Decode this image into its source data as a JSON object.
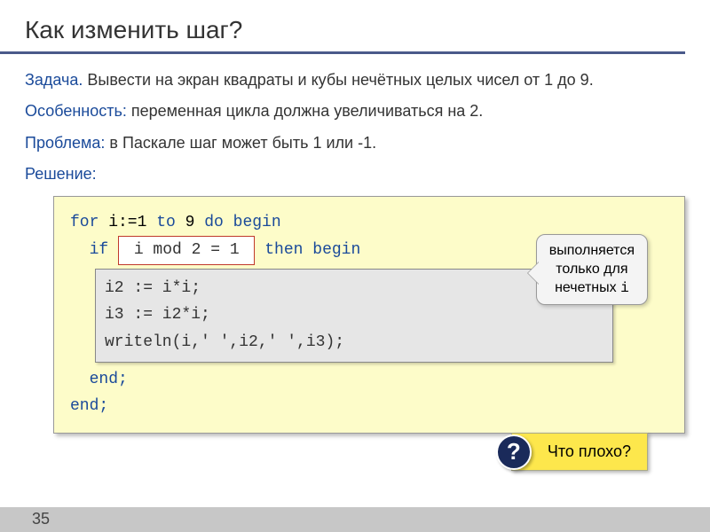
{
  "title": "Как изменить шаг?",
  "task": {
    "label": "Задача.",
    "text": " Вывести на экран квадраты и кубы нечётных целых чисел от 1 до 9."
  },
  "feature": {
    "label": "Особенность:",
    "text": " переменная цикла должна увеличиваться на 2."
  },
  "problem": {
    "label": "Проблема:",
    "text": " в Паскале шаг может быть 1 или -1."
  },
  "solution_label": "Решение:",
  "code": {
    "line1_a": "for",
    "line1_b": " i:=1 ",
    "line1_c": "to",
    "line1_d": " 9 ",
    "line1_e": "do begin",
    "line2_a": "  if ",
    "line2_cond": " i mod 2 = 1 ",
    "line2_b": " then begin",
    "inner": "i2 := i*i;\ni3 := i2*i;\nwriteln(i,' ',i2,' ',i3);",
    "line3": "  end;",
    "line4": "end;"
  },
  "callout_top": {
    "l1": "выполняется",
    "l2": "только для",
    "l3_a": "нечетных ",
    "l3_b": "i"
  },
  "callout_bottom": {
    "badge": "?",
    "text": "Что плохо?"
  },
  "page": "35"
}
